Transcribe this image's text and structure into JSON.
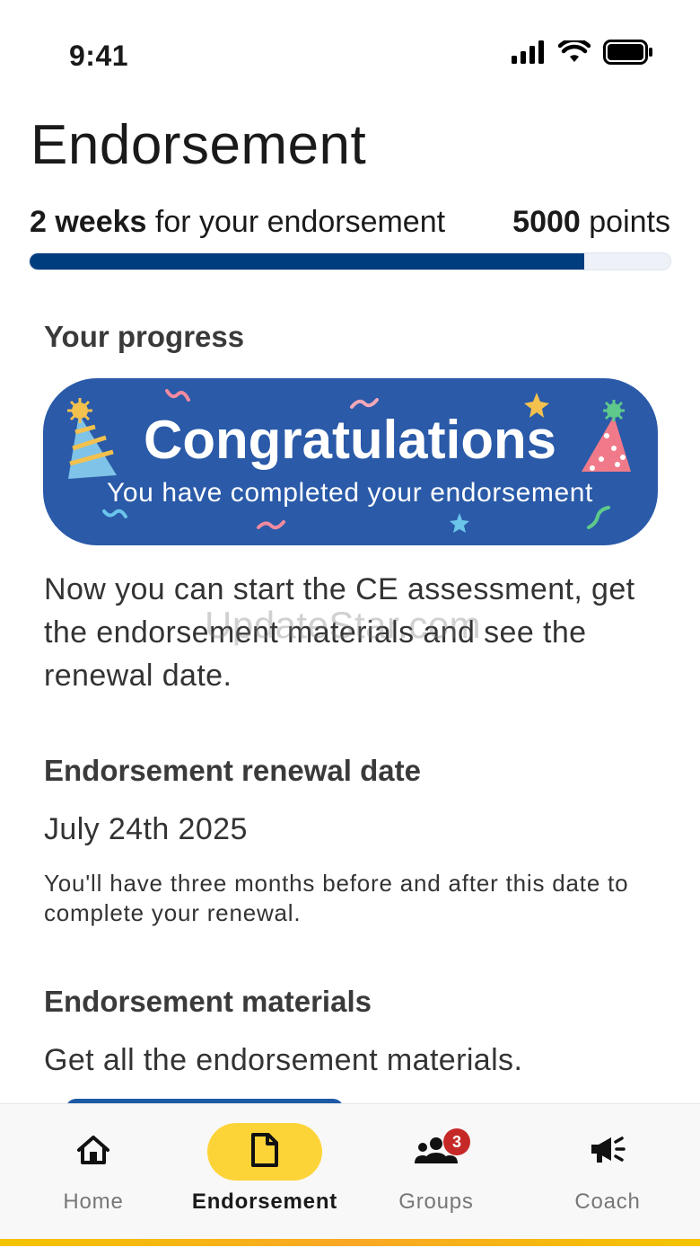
{
  "status_bar": {
    "time": "9:41"
  },
  "header": {
    "title": "Endorsement"
  },
  "progress": {
    "duration_bold": "2 weeks",
    "duration_rest": " for your endorsement",
    "points_bold": "5000",
    "points_rest": " points",
    "fraction": 0.865
  },
  "progress_section": {
    "heading": "Your progress",
    "banner_title": "Congratulations",
    "banner_subtitle": "You have completed your endorsement",
    "description": "Now you can start the CE assessment, get the endorsement materials and see the renewal date."
  },
  "watermark": "UpdateStar.com",
  "renewal": {
    "heading": "Endorsement renewal date",
    "date": "July 24th 2025",
    "note": "You'll have three months before and after this date to complete your renewal."
  },
  "materials": {
    "heading": "Endorsement materials",
    "description": "Get all the endorsement materials."
  },
  "nav": {
    "items": [
      {
        "label": "Home",
        "icon": "home-icon",
        "active": false
      },
      {
        "label": "Endorsement",
        "icon": "document-icon",
        "active": true
      },
      {
        "label": "Groups",
        "icon": "groups-icon",
        "active": false,
        "badge": "3"
      },
      {
        "label": "Coach",
        "icon": "megaphone-icon",
        "active": false
      }
    ]
  },
  "colors": {
    "primary": "#003d7e",
    "banner": "#2a5aa8",
    "accent": "#fdd438",
    "badge": "#c62828"
  }
}
